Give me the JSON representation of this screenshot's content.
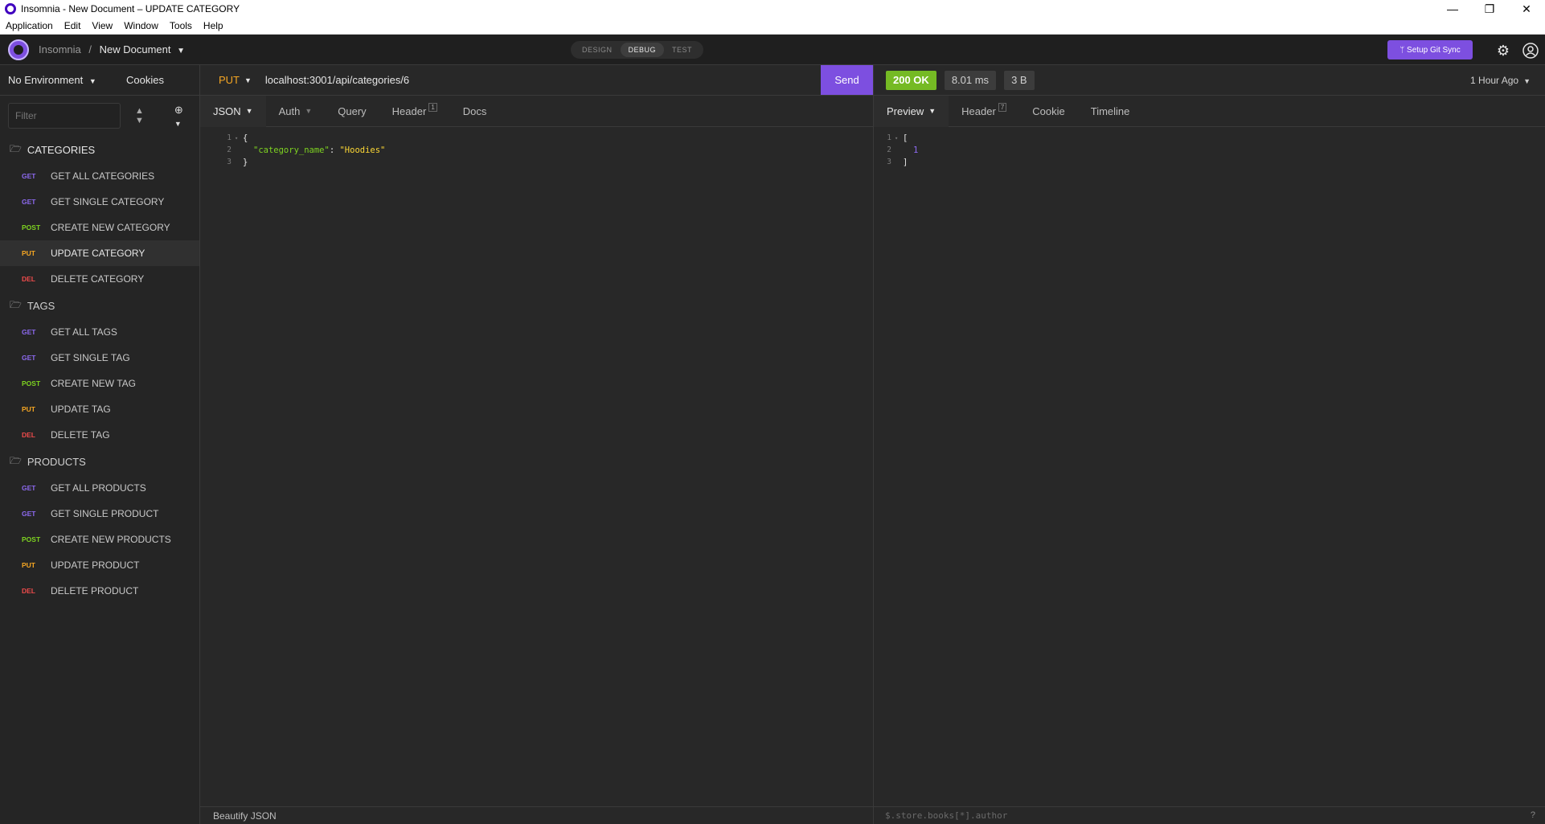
{
  "window": {
    "title": "Insomnia - New Document – UPDATE CATEGORY",
    "controls": {
      "minimize": "—",
      "restore": "❐",
      "close": "✕"
    }
  },
  "menu": [
    "Application",
    "Edit",
    "View",
    "Window",
    "Tools",
    "Help"
  ],
  "header": {
    "app_name": "Insomnia",
    "separator": "/",
    "document": "New Document",
    "modes": [
      "DESIGN",
      "DEBUG",
      "TEST"
    ],
    "active_mode": "DEBUG",
    "git_sync_label": "ᛘ Setup Git Sync",
    "accent": "#7d4fe0"
  },
  "sidebar": {
    "environment": "No Environment",
    "cookies": "Cookies",
    "filter_placeholder": "Filter",
    "folders": [
      {
        "name": "CATEGORIES",
        "open": true,
        "requests": [
          {
            "method": "GET",
            "name": "GET ALL CATEGORIES"
          },
          {
            "method": "GET",
            "name": "GET SINGLE CATEGORY"
          },
          {
            "method": "POST",
            "name": "CREATE NEW CATEGORY"
          },
          {
            "method": "PUT",
            "name": "UPDATE CATEGORY",
            "active": true
          },
          {
            "method": "DEL",
            "name": "DELETE CATEGORY"
          }
        ]
      },
      {
        "name": "TAGS",
        "open": false,
        "requests": [
          {
            "method": "GET",
            "name": "GET ALL TAGS"
          },
          {
            "method": "GET",
            "name": "GET SINGLE TAG"
          },
          {
            "method": "POST",
            "name": "CREATE NEW TAG"
          },
          {
            "method": "PUT",
            "name": "UPDATE TAG"
          },
          {
            "method": "DEL",
            "name": "DELETE TAG"
          }
        ]
      },
      {
        "name": "PRODUCTS",
        "open": false,
        "requests": [
          {
            "method": "GET",
            "name": "GET ALL PRODUCTS"
          },
          {
            "method": "GET",
            "name": "GET SINGLE PRODUCT"
          },
          {
            "method": "POST",
            "name": "CREATE NEW PRODUCTS"
          },
          {
            "method": "PUT",
            "name": "UPDATE PRODUCT"
          },
          {
            "method": "DEL",
            "name": "DELETE PRODUCT"
          }
        ]
      }
    ]
  },
  "request": {
    "method": "PUT",
    "url": "localhost:3001/api/categories/6",
    "send_label": "Send",
    "tabs": {
      "body": "JSON",
      "auth": "Auth",
      "query": "Query",
      "header": "Header",
      "header_count": "1",
      "docs": "Docs"
    },
    "body_lines": [
      "1",
      "2",
      "3"
    ],
    "body": {
      "open": "{",
      "key": "\"category_name\"",
      "colon": ": ",
      "value": "\"Hoodies\"",
      "close": "}"
    },
    "footer_label": "Beautify JSON"
  },
  "response": {
    "status": "200 OK",
    "time": "8.01 ms",
    "size": "3 B",
    "time_ago": "1 Hour Ago",
    "tabs": {
      "preview": "Preview",
      "header": "Header",
      "header_count": "7",
      "cookie": "Cookie",
      "timeline": "Timeline"
    },
    "body_lines": [
      "1",
      "2",
      "3"
    ],
    "body": {
      "open": "[",
      "value": "1",
      "close": "]"
    },
    "filter_placeholder": "$.store.books[*].author",
    "help": "?"
  }
}
